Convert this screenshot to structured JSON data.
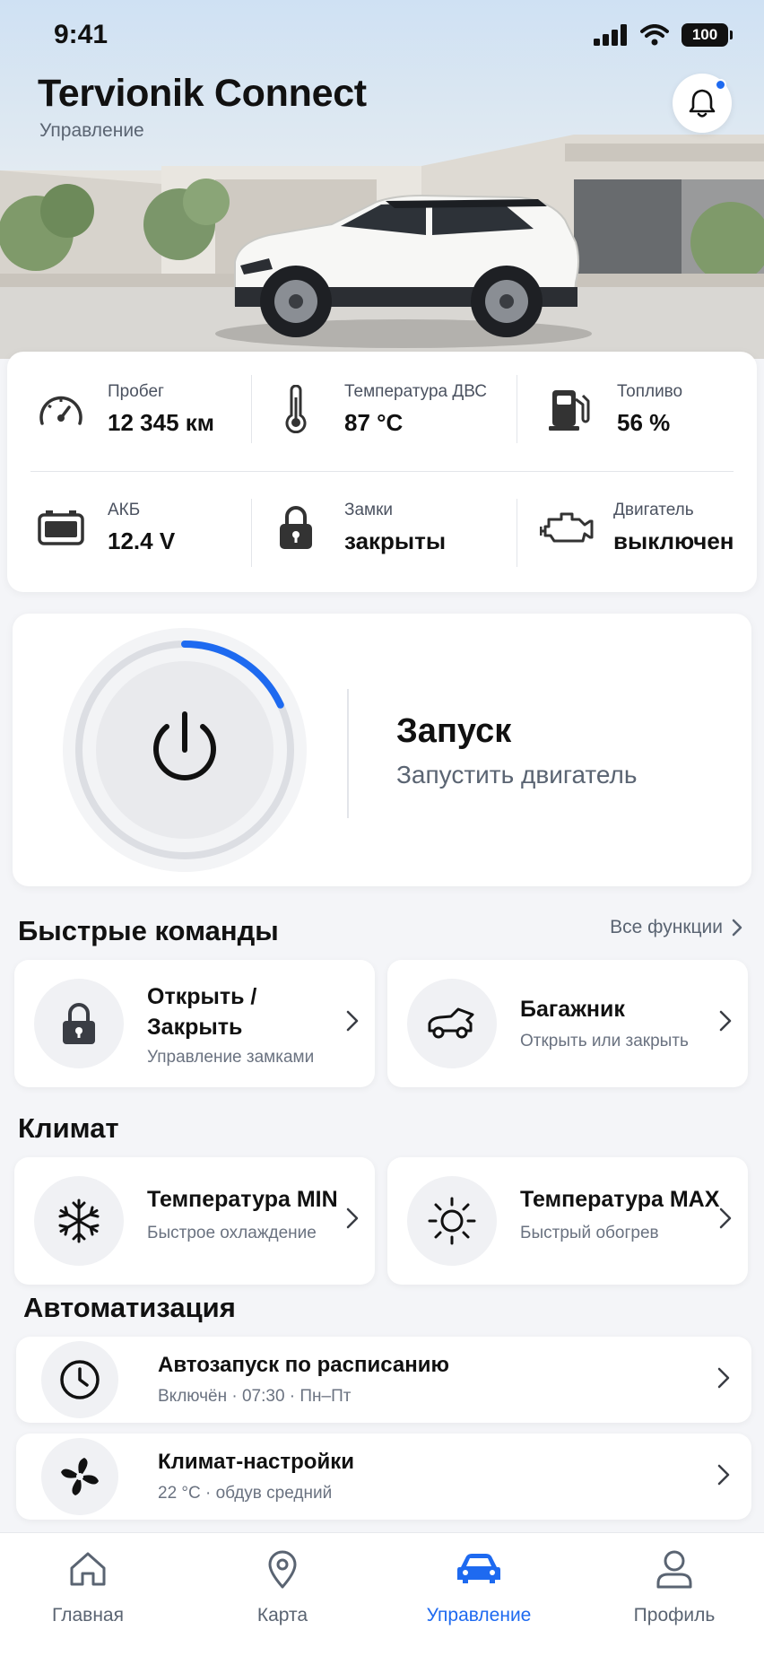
{
  "status_bar": {
    "time": "9:41",
    "battery": "100"
  },
  "header": {
    "title": "Tervionik Connect",
    "subtitle": "Управление"
  },
  "stats": [
    {
      "label": "Пробег",
      "value": "12 345 км",
      "icon": "speedometer-icon"
    },
    {
      "label": "Температура ДВС",
      "value": "87 °C",
      "icon": "thermometer-icon"
    },
    {
      "label": "Топливо",
      "value": "56 %",
      "icon": "fuel-pump-icon"
    },
    {
      "label": "АКБ",
      "value": "12.4 V",
      "icon": "car-battery-icon"
    },
    {
      "label": "Замки",
      "value": "закрыты",
      "icon": "lock-icon"
    },
    {
      "label": "Двигатель",
      "value": "выключен",
      "icon": "engine-icon"
    }
  ],
  "start": {
    "title": "Запуск",
    "subtitle": "Запустить двигатель",
    "progress": 0.18,
    "accent": "#1e6af0"
  },
  "quick": {
    "title": "Быстрые команды",
    "see_all": "Все функции",
    "items": [
      {
        "title_line1": "Открыть /",
        "title_line2": "Закрыть",
        "subtitle": "Управление замками"
      },
      {
        "title": "Багажник",
        "subtitle": "Открыть или закрыть"
      }
    ]
  },
  "climate": {
    "title": "Климат",
    "items": [
      {
        "title": "Температура MIN",
        "subtitle": "Быстрое охлаждение"
      },
      {
        "title": "Температура MAX",
        "subtitle": "Быстрый обогрев"
      }
    ]
  },
  "automation": {
    "title": "Автоматизация",
    "items": [
      {
        "title": "Автозапуск по расписанию",
        "subtitle": "Включён · 07:30 · Пн–Пт"
      },
      {
        "title": "Климат-настройки",
        "subtitle": "22 °C · обдув средний"
      }
    ]
  },
  "tabs": [
    {
      "label": "Главная"
    },
    {
      "label": "Карта"
    },
    {
      "label": "Управление",
      "active": true
    },
    {
      "label": "Профиль"
    }
  ]
}
